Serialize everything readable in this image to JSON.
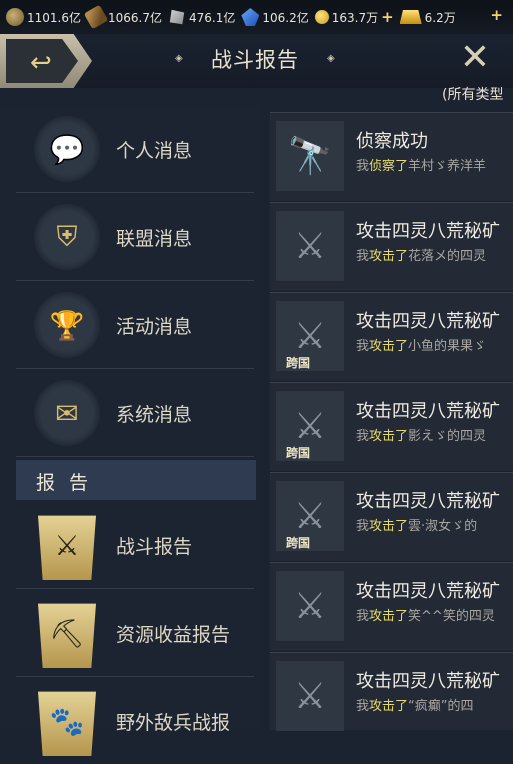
{
  "resources": [
    {
      "icon": "food-icon",
      "value": "1101.6亿"
    },
    {
      "icon": "wood-icon",
      "value": "1066.7亿"
    },
    {
      "icon": "stone-icon",
      "value": "476.1亿"
    },
    {
      "icon": "iron-icon",
      "value": "106.2亿"
    },
    {
      "icon": "coin-icon",
      "value": "163.7万"
    },
    {
      "icon": "gold-icon",
      "value": "6.2万"
    }
  ],
  "header": {
    "title": "战斗报告",
    "filter": "(所有类型"
  },
  "menu": [
    {
      "label": "个人消息",
      "icon": "chat-bubbles-icon"
    },
    {
      "label": "联盟消息",
      "icon": "alliance-shield-icon"
    },
    {
      "label": "活动消息",
      "icon": "trophy-icon"
    },
    {
      "label": "系统消息",
      "icon": "envelope-gear-icon"
    }
  ],
  "section": {
    "label": "报告"
  },
  "reports_menu": [
    {
      "label": "战斗报告",
      "icon": "crossed-swords-icon"
    },
    {
      "label": "资源收益报告",
      "icon": "pickaxe-icon"
    },
    {
      "label": "野外敌兵战报",
      "icon": "paw-icon"
    }
  ],
  "reports": [
    {
      "title": "侦察成功",
      "pre": "我",
      "verb": "侦察了",
      "obj": "羊村ゞ养洋羊",
      "tag": ""
    },
    {
      "title": "攻击四灵八荒秘矿",
      "pre": "我",
      "verb": "攻击了",
      "obj": "花落メ的四灵",
      "tag": ""
    },
    {
      "title": "攻击四灵八荒秘矿",
      "pre": "我",
      "verb": "攻击了",
      "obj": "小鱼的果果ゞ",
      "tag": "跨国"
    },
    {
      "title": "攻击四灵八荒秘矿",
      "pre": "我",
      "verb": "攻击了",
      "obj": "影えゞ的四灵",
      "tag": "跨国"
    },
    {
      "title": "攻击四灵八荒秘矿",
      "pre": "我",
      "verb": "攻击了",
      "obj": "雲·淑女ゞ的",
      "tag": "跨国"
    },
    {
      "title": "攻击四灵八荒秘矿",
      "pre": "我",
      "verb": "攻击了",
      "obj": "笑^^笑的四灵",
      "tag": ""
    },
    {
      "title": "攻击四灵八荒秘矿",
      "pre": "我",
      "verb": "攻击了",
      "obj": "“疯癫”的四",
      "tag": ""
    }
  ],
  "colors": {
    "highlight": "#e5da6f",
    "section_bg": "#2e3b50",
    "gold": "#d9bd6e"
  }
}
